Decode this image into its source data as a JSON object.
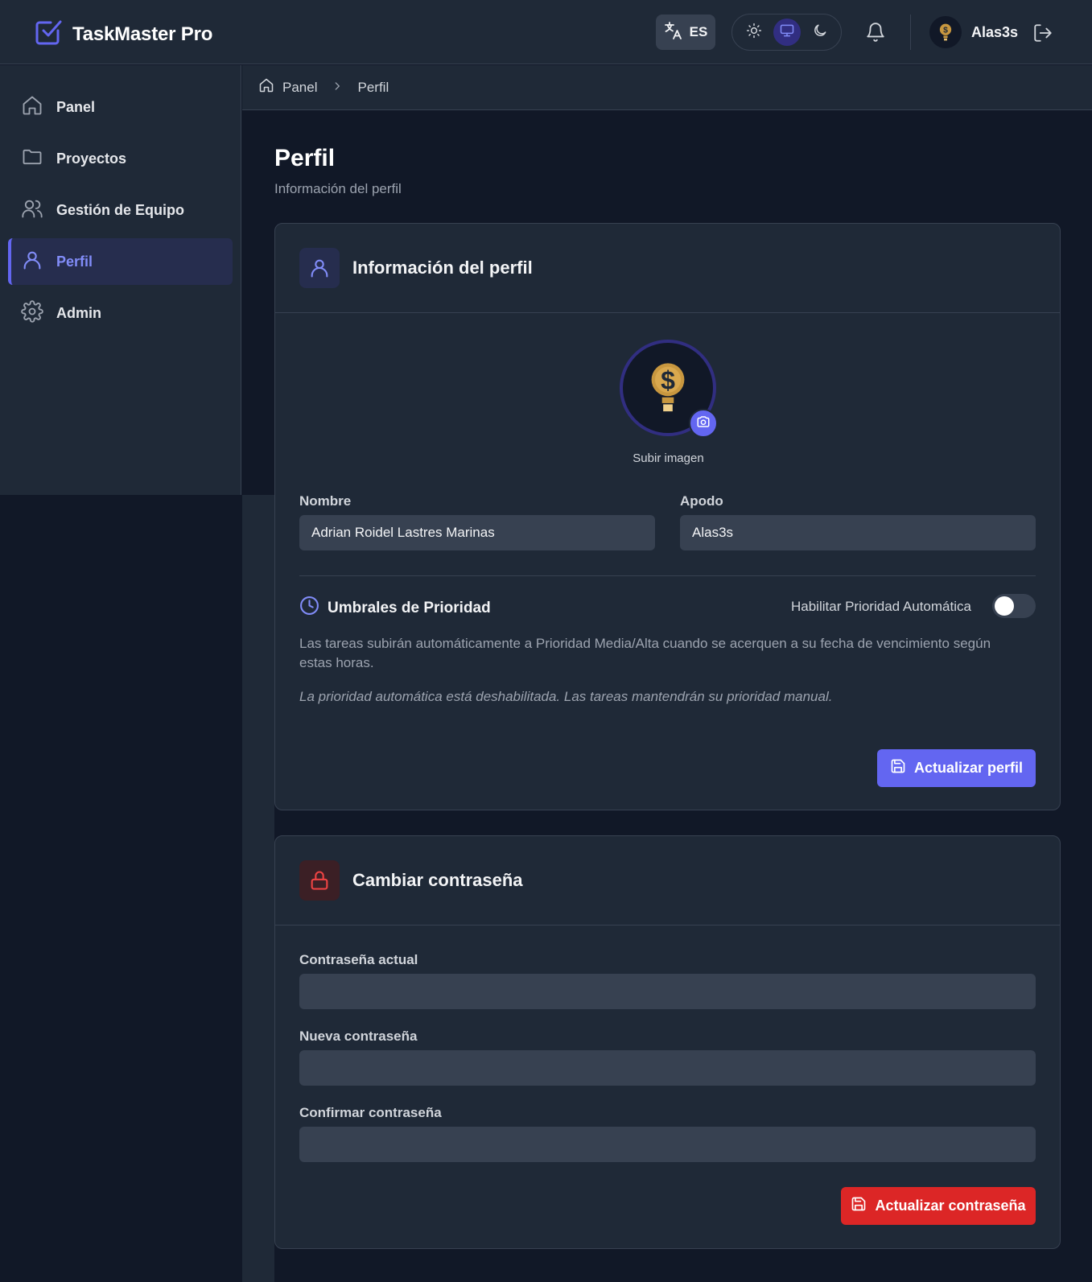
{
  "app": {
    "title": "TaskMaster Pro"
  },
  "header": {
    "language_code": "ES",
    "theme_options": [
      "light",
      "system",
      "dark"
    ],
    "active_theme": "system",
    "user_name": "Alas3s"
  },
  "sidebar": {
    "items": [
      {
        "label": "Panel",
        "icon": "home-icon"
      },
      {
        "label": "Proyectos",
        "icon": "folder-icon"
      },
      {
        "label": "Gestión de Equipo",
        "icon": "users-icon"
      },
      {
        "label": "Perfil",
        "icon": "user-icon",
        "active": true
      },
      {
        "label": "Admin",
        "icon": "gear-icon"
      }
    ]
  },
  "breadcrumb": {
    "items": [
      "Panel",
      "Perfil"
    ]
  },
  "page": {
    "title": "Perfil",
    "subtitle": "Información del perfil"
  },
  "profile_card": {
    "title": "Información del perfil",
    "upload_label": "Subir imagen",
    "name_label": "Nombre",
    "name_value": "Adrian Roidel Lastres Marinas",
    "nickname_label": "Apodo",
    "nickname_value": "Alas3s",
    "priority_title": "Umbrales de Prioridad",
    "auto_priority_label": "Habilitar Prioridad Automática",
    "auto_priority_enabled": false,
    "description": "Las tareas subirán automáticamente a Prioridad Media/Alta cuando se acerquen a su fecha de vencimiento según estas horas.",
    "disabled_note": "La prioridad automática está deshabilitada. Las tareas mantendrán su prioridad manual.",
    "submit_label": "Actualizar perfil"
  },
  "password_card": {
    "title": "Cambiar contraseña",
    "current_label": "Contraseña actual",
    "new_label": "Nueva contraseña",
    "confirm_label": "Confirmar contraseña",
    "submit_label": "Actualizar contraseña"
  },
  "colors": {
    "accent": "#6366f1",
    "danger": "#dc2626",
    "background": "#111827",
    "surface": "#1f2937",
    "input": "#374151"
  }
}
